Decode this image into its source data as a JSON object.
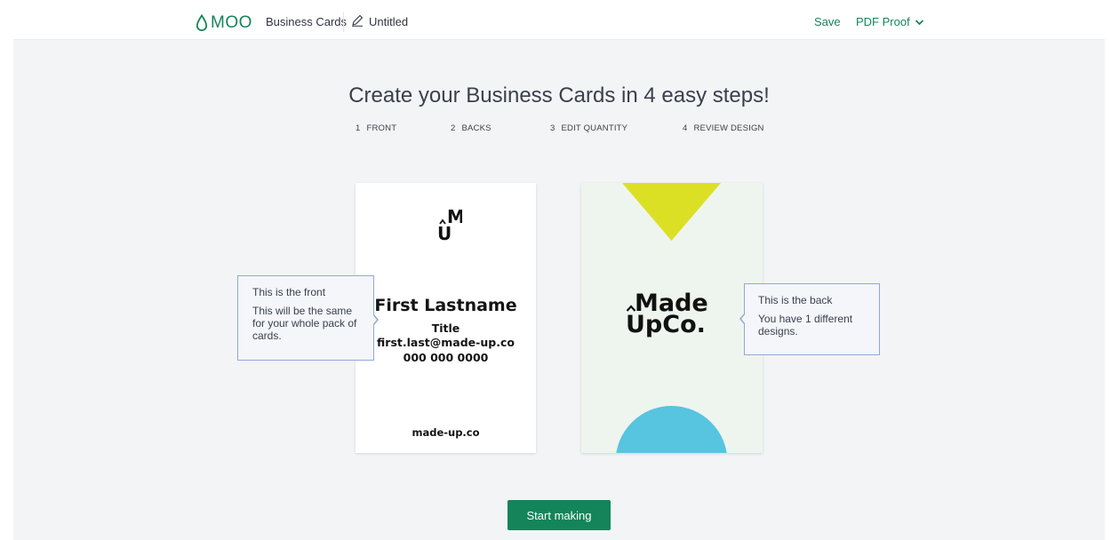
{
  "header": {
    "logo_text": "MOO",
    "product": "Business Cards",
    "document_title": "Untitled",
    "save_label": "Save",
    "pdf_proof_label": "PDF Proof",
    "accent_color": "#14845a"
  },
  "main": {
    "heading": "Create your Business Cards in 4 easy steps!",
    "steps": [
      {
        "num": "1",
        "label": "FRONT"
      },
      {
        "num": "2",
        "label": "BACKS"
      },
      {
        "num": "3",
        "label": "EDIT QUANTITY"
      },
      {
        "num": "4",
        "label": "REVIEW DESIGN"
      }
    ],
    "front_card": {
      "logo_letters": "UM",
      "name": "First Lastname",
      "title": "Title",
      "email": "first.last@made-up.co",
      "phone": "000 000 0000",
      "website": "made-up.co"
    },
    "back_card": {
      "logo_line1": "Made",
      "logo_line2": "UpCo.",
      "triangle_color": "#dce024",
      "circle_color": "#57c4e0",
      "background_color": "#eef5ef"
    },
    "front_tip": {
      "title": "This is the front",
      "body": "This will be the same for your whole pack of cards."
    },
    "back_tip": {
      "title": "This is the back",
      "body_line1": "You have 1 different",
      "body_line2": "designs."
    },
    "start_button": "Start making"
  }
}
